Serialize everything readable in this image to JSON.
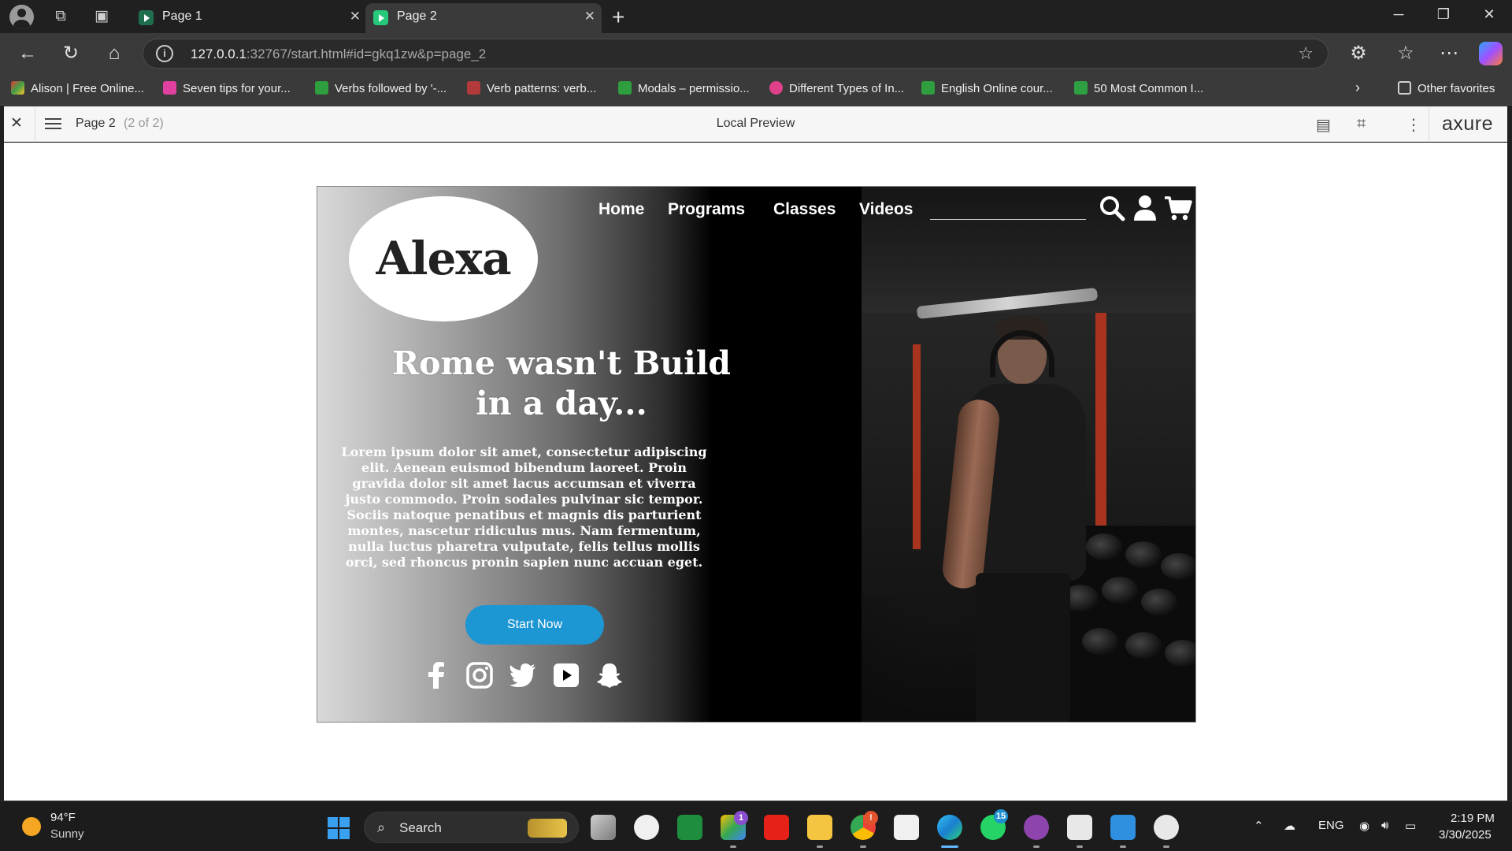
{
  "browser": {
    "tabs": [
      {
        "title": "Page 1"
      },
      {
        "title": "Page 2"
      }
    ],
    "url_host": "127.0.0.1",
    "url_rest": ":32767/start.html#id=gkq1zw&p=page_2",
    "bookmarks": [
      "Alison | Free Online...",
      "Seven tips for your...",
      "Verbs followed by '-...",
      "Verb patterns: verb...",
      "Modals – permissio...",
      "Different Types of In...",
      "English Online cour...",
      "50 Most Common I..."
    ],
    "other_favorites": "Other favorites"
  },
  "axure": {
    "page_name": "Page 2",
    "page_count": "(2 of 2)",
    "preview_title": "Local Preview",
    "logo": "axure"
  },
  "site": {
    "logo": "Alexa",
    "nav": [
      "Home",
      "Programs",
      "Classes",
      "Videos"
    ],
    "headline_line1": "Rome wasn't Build",
    "headline_line2": "in a day...",
    "body": "Lorem ipsum dolor sit amet, consectetur adipiscing elit. Aenean euismod bibendum laoreet. Proin gravida dolor sit amet lacus accumsan et viverra justo commodo. Proin sodales pulvinar sic tempor. Sociis natoque penatibus et magnis dis parturient montes, nascetur ridiculus mus. Nam fermentum, nulla luctus pharetra vulputate, felis tellus mollis orci, sed rhoncus pronin sapien nunc accuan eget.",
    "cta": "Start Now",
    "social_icons": [
      "facebook-icon",
      "instagram-icon",
      "twitter-icon",
      "youtube-icon",
      "snapchat-icon"
    ],
    "button_color": "#1d96d4"
  },
  "taskbar": {
    "weather_temp": "94°F",
    "weather_desc": "Sunny",
    "search_label": "Search",
    "language": "ENG",
    "time": "2:19 PM",
    "date": "3/30/2025",
    "whatsapp_badge": "15",
    "teams_badge": "1"
  }
}
